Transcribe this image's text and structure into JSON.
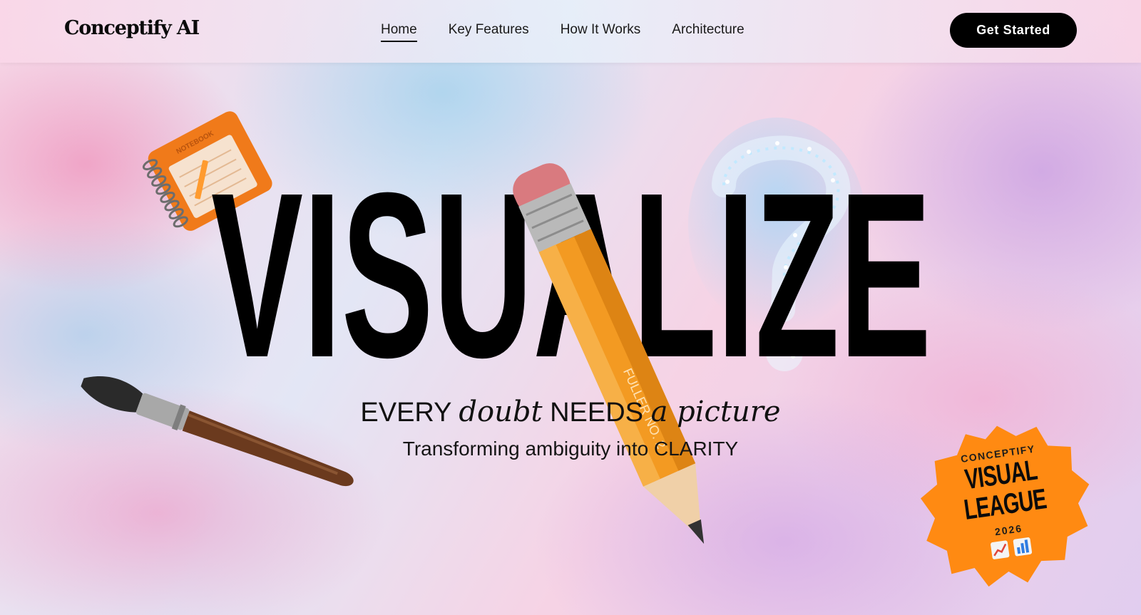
{
  "header": {
    "logo": "Conceptify AI",
    "nav": [
      {
        "label": "Home",
        "active": true
      },
      {
        "label": "Key Features",
        "active": false
      },
      {
        "label": "How It Works",
        "active": false
      },
      {
        "label": "Architecture",
        "active": false
      }
    ],
    "cta_label": "Get Started"
  },
  "hero": {
    "headline": "VISUALIZE",
    "tagline": {
      "part1": "EVERY ",
      "italic1": "doubt",
      "part2": " NEEDS ",
      "italic2": "a picture"
    },
    "subline": "Transforming ambiguity into CLARITY"
  },
  "decor": {
    "notebook_label": "NOTEBOOK",
    "pencil_brand": "FULLER NO. 2"
  },
  "badge": {
    "top": "CONCEPTIFY",
    "line1": "VISUAL",
    "line2": "LEAGUE",
    "year": "2026",
    "icons": [
      "line-chart-icon",
      "bar-chart-icon"
    ],
    "color": "#ff8a12"
  },
  "colors": {
    "primary": "#000000",
    "accent": "#ff8a12",
    "brain_glow": "#5ac8ff"
  }
}
